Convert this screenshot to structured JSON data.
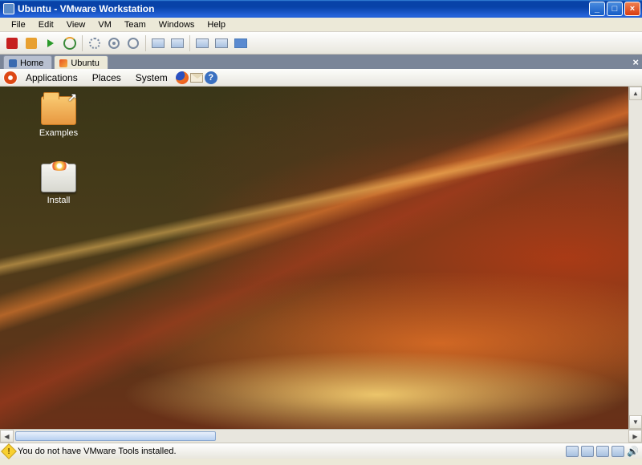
{
  "window": {
    "title": "Ubuntu - VMware Workstation"
  },
  "menu": {
    "file": "File",
    "edit": "Edit",
    "view": "View",
    "vm": "VM",
    "team": "Team",
    "windows": "Windows",
    "help": "Help"
  },
  "vmtabs": {
    "home": "Home",
    "ubuntu": "Ubuntu",
    "close": "×"
  },
  "ubuntu_panel": {
    "applications": "Applications",
    "places": "Places",
    "system": "System",
    "help": "?"
  },
  "desktop": {
    "examples": "Examples",
    "install": "Install"
  },
  "status": {
    "message": "You do not have VMware Tools installed.",
    "speaker": "🔊"
  }
}
